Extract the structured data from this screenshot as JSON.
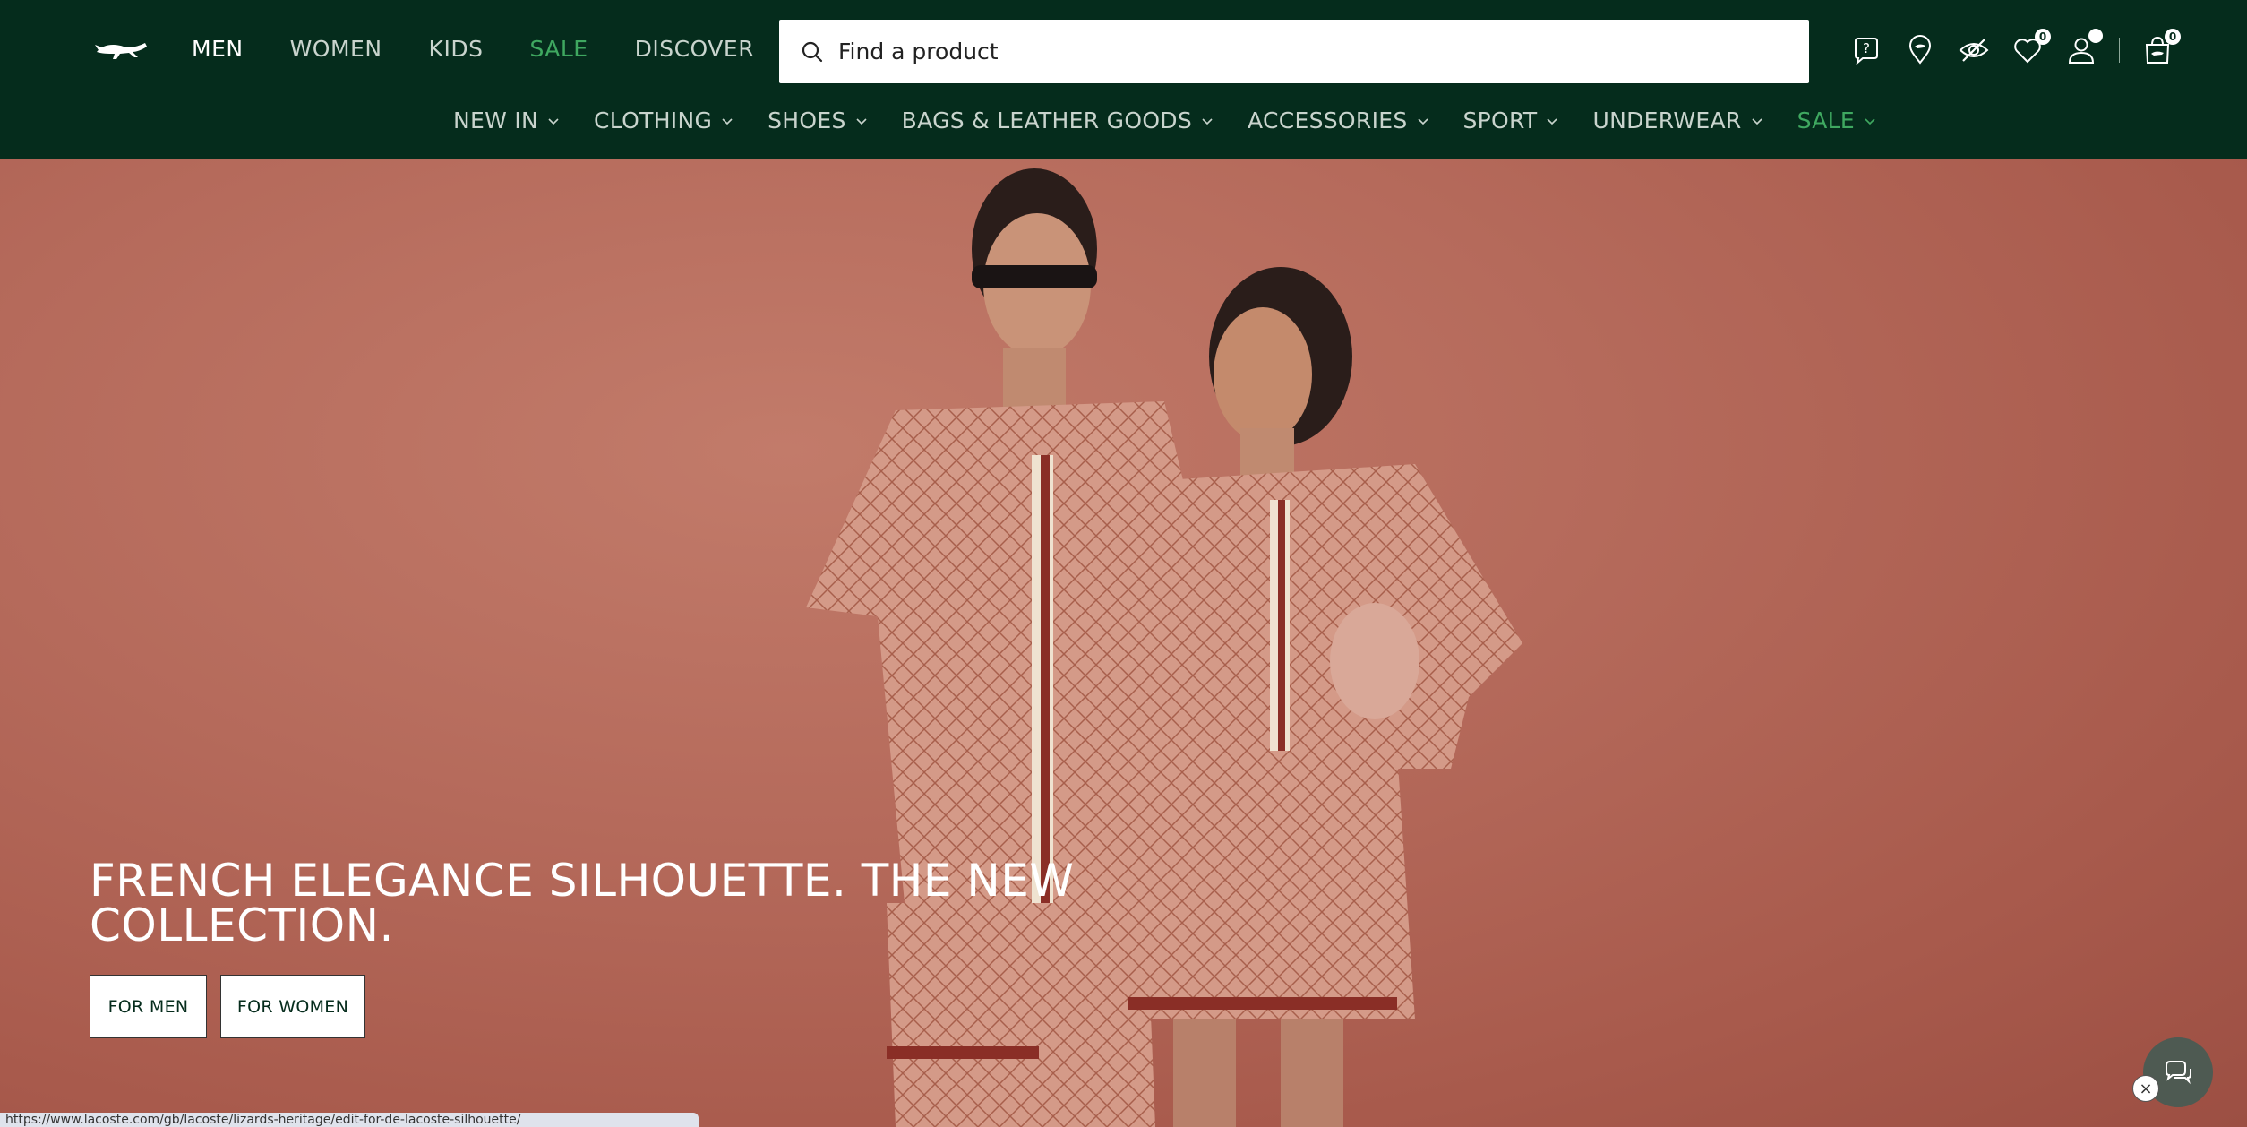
{
  "header": {
    "logo": "lacoste-crocodile-logo",
    "topnav": [
      {
        "label": "MEN",
        "state": "active"
      },
      {
        "label": "WOMEN",
        "state": "normal"
      },
      {
        "label": "KIDS",
        "state": "normal"
      },
      {
        "label": "SALE",
        "state": "sale"
      },
      {
        "label": "DISCOVER",
        "state": "normal"
      }
    ],
    "search": {
      "placeholder": "Find a product",
      "icon": "search-icon"
    },
    "icons": {
      "help": "help-icon",
      "store": "store-locator-icon",
      "accessibility": "eye-off-icon",
      "wishlist": {
        "icon": "heart-icon",
        "count": "0"
      },
      "account": "user-icon",
      "bag": {
        "icon": "shopping-bag-icon",
        "count": "0"
      }
    },
    "subnav": [
      {
        "label": "NEW IN",
        "sale": false
      },
      {
        "label": "CLOTHING",
        "sale": false
      },
      {
        "label": "SHOES",
        "sale": false
      },
      {
        "label": "BAGS & LEATHER GOODS",
        "sale": false
      },
      {
        "label": "ACCESSORIES",
        "sale": false
      },
      {
        "label": "SPORT",
        "sale": false
      },
      {
        "label": "UNDERWEAR",
        "sale": false
      },
      {
        "label": "SALE",
        "sale": true
      }
    ]
  },
  "hero": {
    "headline": "FRENCH ELEGANCE SILHOUETTE. THE NEW COLLECTION.",
    "buttons": {
      "men": "FOR MEN",
      "women": "FOR WOMEN"
    }
  },
  "chat": {
    "icon": "chat-icon",
    "close_icon": "close-icon"
  },
  "statusbar": {
    "url": "https://www.lacoste.com/gb/lacoste/lizards-heritage/edit-for-de-lacoste-silhouette/"
  },
  "colors": {
    "header_bg": "#052c1c",
    "sale_green": "#3fa860",
    "hero_bg": "#b56a5b"
  }
}
